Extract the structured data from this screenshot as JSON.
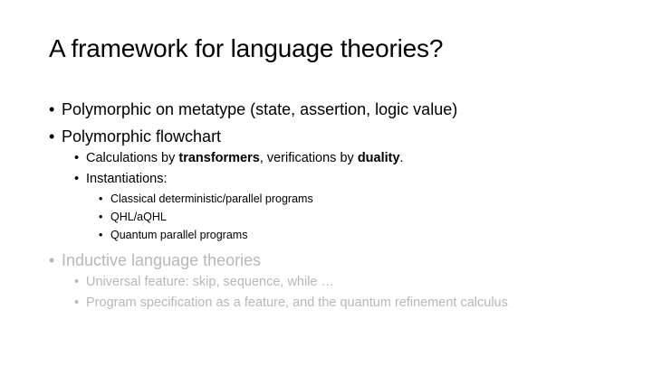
{
  "slide": {
    "title": "A framework for language theories?",
    "bullet_glyph": "•",
    "colors": {
      "text": "#000000",
      "muted_text": "#b8b8b8",
      "background": "#ffffff"
    },
    "items": {
      "polymorphic_metatype": "Polymorphic on metatype (state, assertion, logic value)",
      "polymorphic_flowchart": "Polymorphic flowchart",
      "calculations": {
        "part1": "Calculations by ",
        "bold1": "transformers",
        "part2": ", verifications by ",
        "bold2": "duality",
        "part3": "."
      },
      "instantiations": "Instantiations:",
      "classical": "Classical deterministic/parallel programs",
      "qhl": "QHL/aQHL",
      "quantum_parallel": "Quantum parallel programs",
      "inductive": "Inductive language theories",
      "universal_feature": "Universal feature: skip, sequence, while …",
      "program_specification": "Program specification as a feature, and the quantum refinement calculus"
    }
  }
}
